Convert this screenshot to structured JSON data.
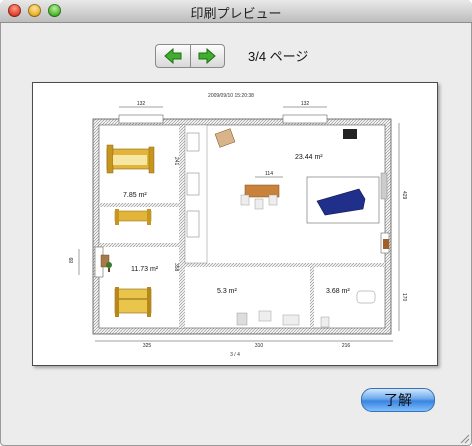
{
  "window": {
    "title": "印刷プレビュー"
  },
  "nav": {
    "prev_icon": "arrow-left-icon",
    "next_icon": "arrow-right-icon",
    "page_label": "3/4 ページ"
  },
  "plan": {
    "timestamp": "2009/09/10 15:20:38",
    "page_number": "3 / 4",
    "dims_top": [
      "132",
      "132"
    ],
    "dim_center": "114",
    "dims_bottom": [
      "325",
      "310",
      "216"
    ],
    "dims_right": [
      "429",
      "170"
    ],
    "dims_left": [
      "89",
      "358",
      "241"
    ],
    "rooms": [
      {
        "label": "7.85 m²"
      },
      {
        "label": "11.73 m²"
      },
      {
        "label": "23.44 m²"
      },
      {
        "label": "5.3 m²"
      },
      {
        "label": "3.68 m²"
      }
    ]
  },
  "footer": {
    "ok_label": "了解"
  },
  "colors": {
    "accent": "#3a83e0",
    "wall": "#555555",
    "bed": "#e2b43a",
    "sofa": "#1f2f8a"
  }
}
